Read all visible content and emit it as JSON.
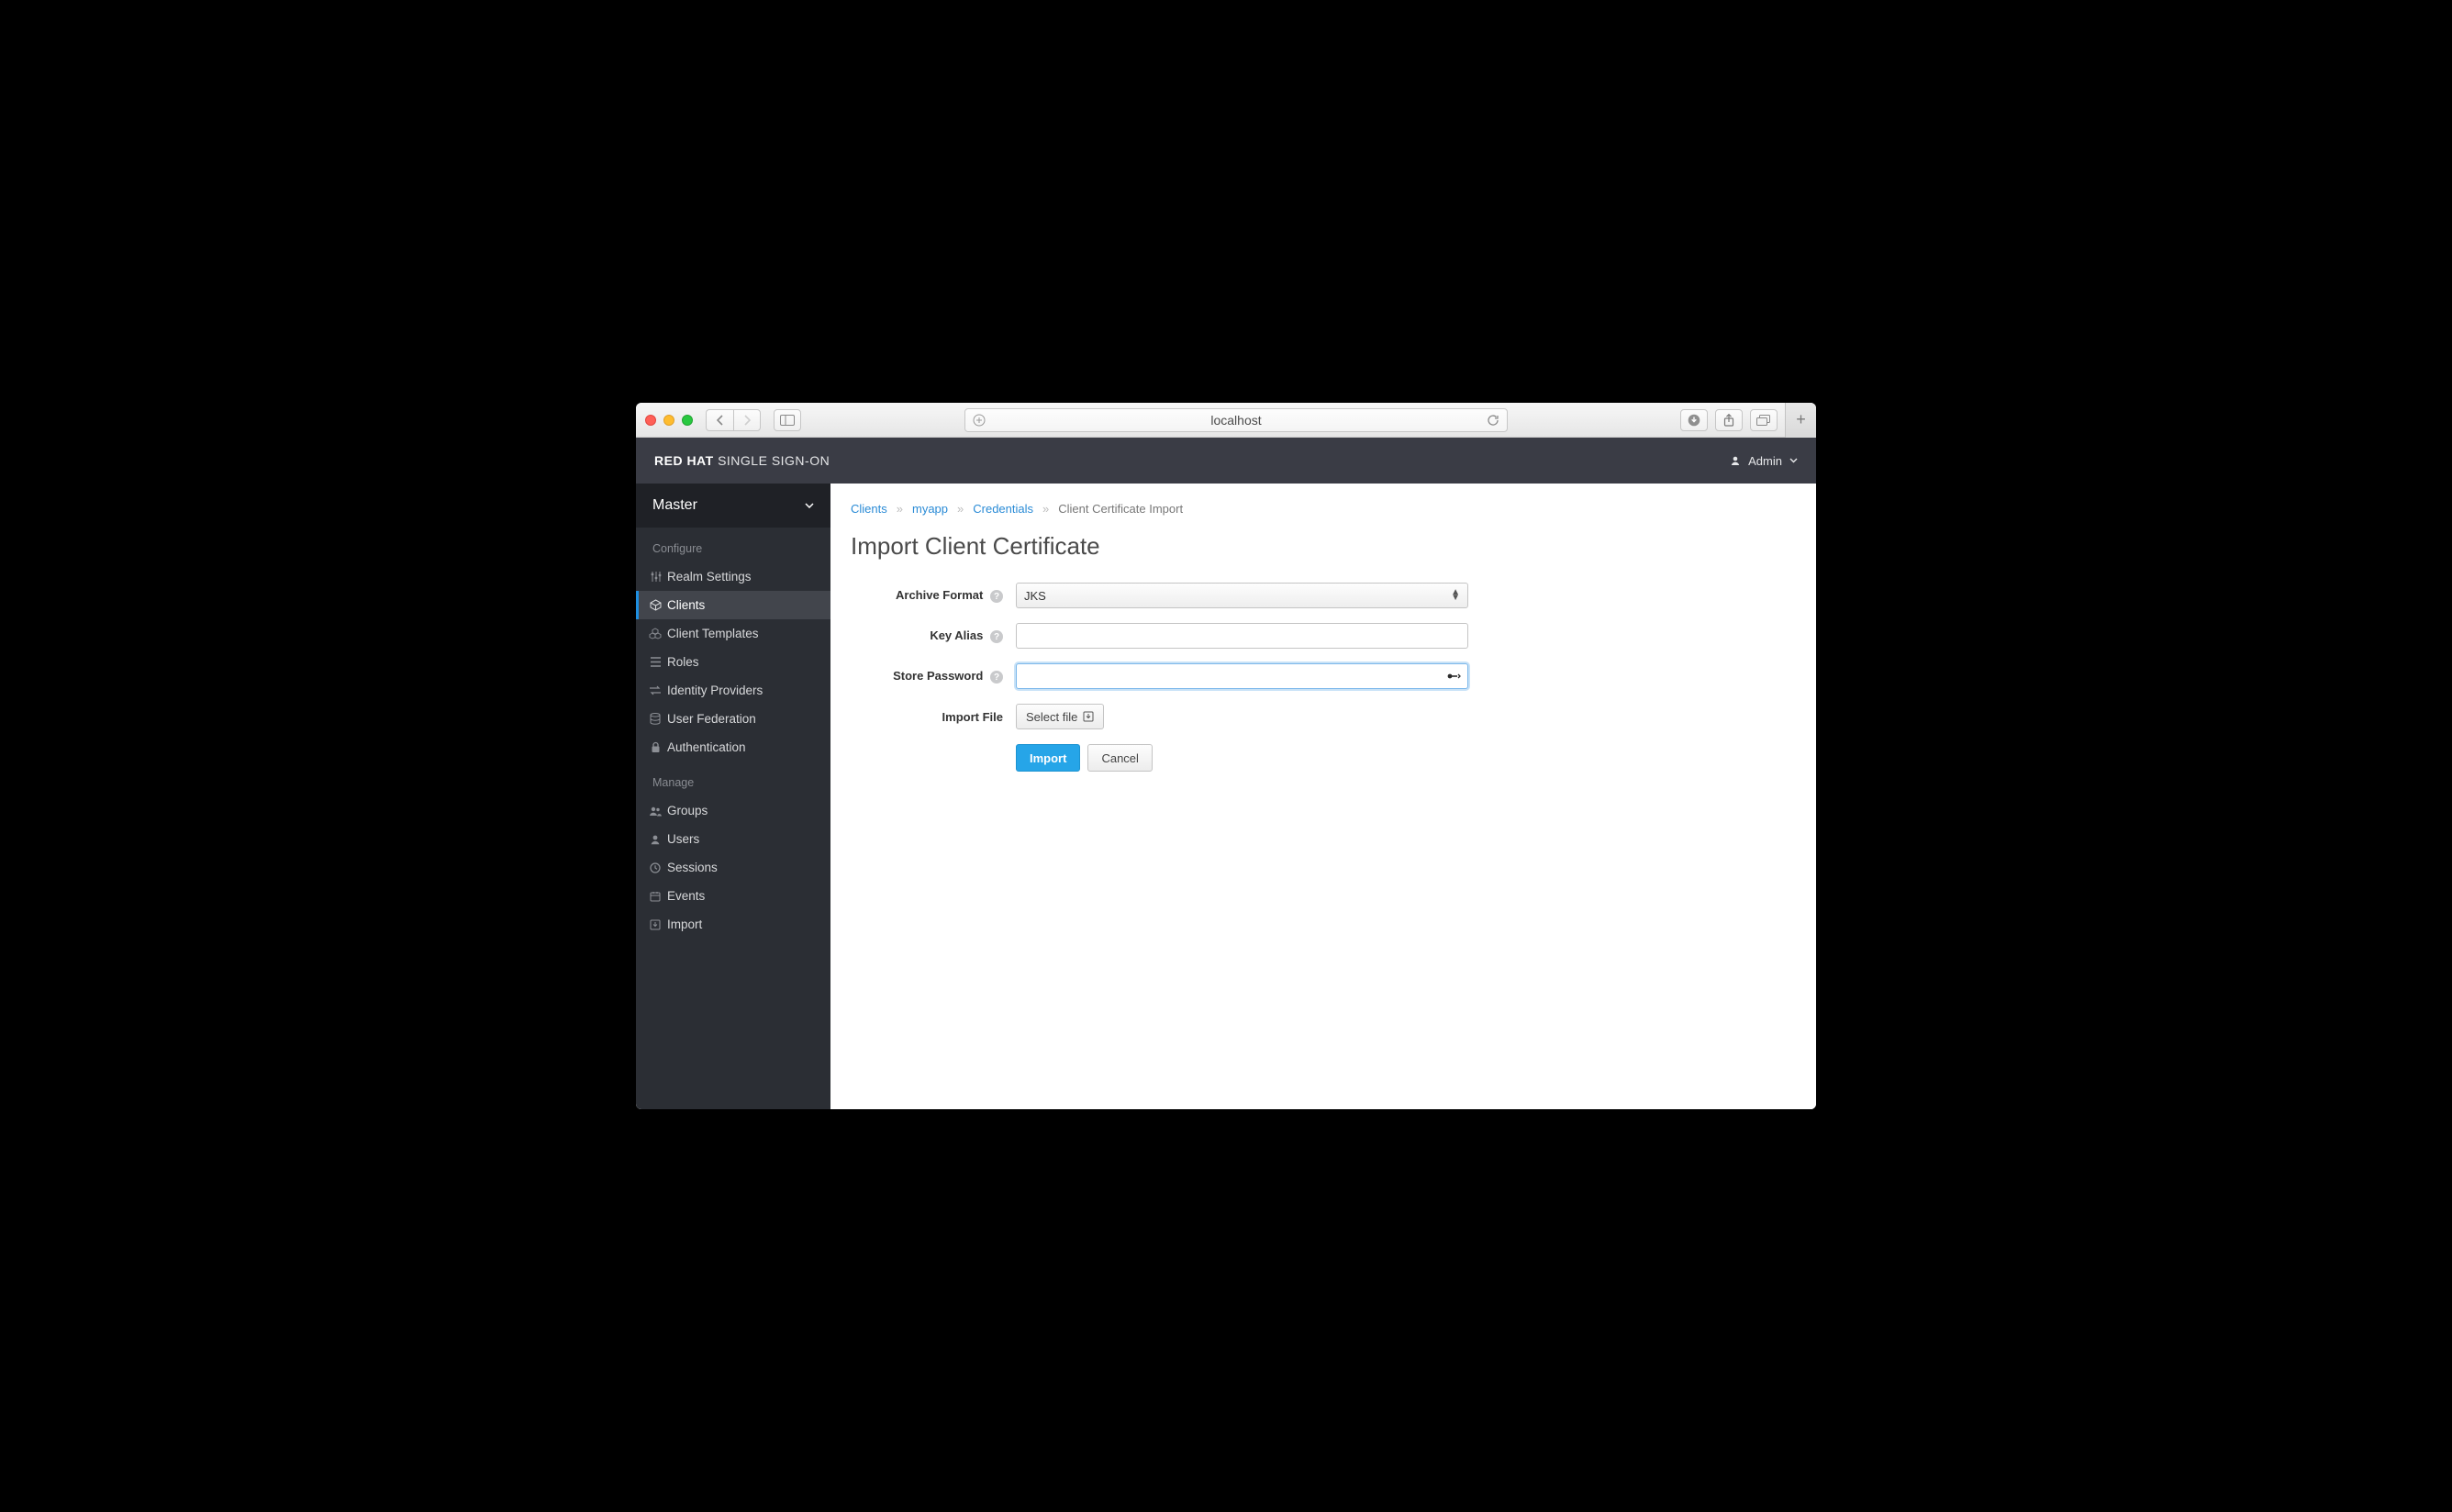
{
  "browser": {
    "host": "localhost"
  },
  "brand": {
    "bold": "RED HAT",
    "light": "SINGLE SIGN-ON"
  },
  "user": {
    "name": "Admin"
  },
  "realm": {
    "name": "Master"
  },
  "sidebar": {
    "sections": [
      {
        "label": "Configure",
        "items": [
          {
            "label": "Realm Settings"
          },
          {
            "label": "Clients"
          },
          {
            "label": "Client Templates"
          },
          {
            "label": "Roles"
          },
          {
            "label": "Identity Providers"
          },
          {
            "label": "User Federation"
          },
          {
            "label": "Authentication"
          }
        ]
      },
      {
        "label": "Manage",
        "items": [
          {
            "label": "Groups"
          },
          {
            "label": "Users"
          },
          {
            "label": "Sessions"
          },
          {
            "label": "Events"
          },
          {
            "label": "Import"
          }
        ]
      }
    ]
  },
  "crumbs": {
    "c0": "Clients",
    "c1": "myapp",
    "c2": "Credentials",
    "c3": "Client Certificate Import"
  },
  "page": {
    "title": "Import Client Certificate"
  },
  "form": {
    "archive_format": {
      "label": "Archive Format",
      "value": "JKS"
    },
    "key_alias": {
      "label": "Key Alias",
      "value": ""
    },
    "store_password": {
      "label": "Store Password",
      "value": ""
    },
    "import_file": {
      "label": "Import File",
      "button": "Select file"
    },
    "actions": {
      "import": "Import",
      "cancel": "Cancel"
    }
  }
}
